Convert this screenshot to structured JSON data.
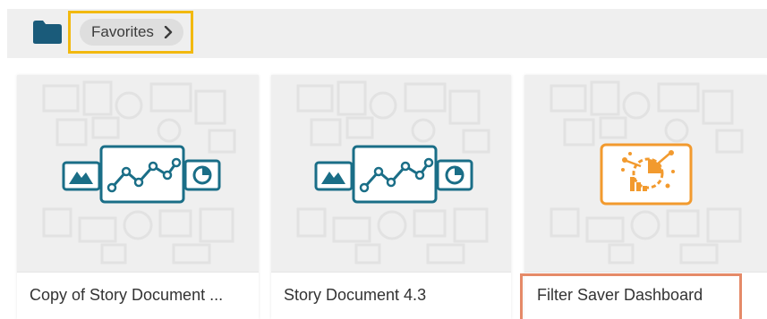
{
  "breadcrumb": {
    "folder_icon": "folder-icon",
    "label": "Favorites",
    "chevron_icon": "chevron-right-icon"
  },
  "cards": [
    {
      "title": "Copy of Story Document ...",
      "icon": "storyboard-chart-icon"
    },
    {
      "title": "Story Document 4.3",
      "icon": "storyboard-chart-icon"
    },
    {
      "title": "Filter Saver Dashboard",
      "icon": "dashboard-analytics-icon"
    }
  ],
  "colors": {
    "accent_teal": "#1a6e87",
    "dashboard_orange": "#f29a2e",
    "breadcrumb_highlight": "#f2b90f",
    "card_highlight": "#e58a68"
  }
}
